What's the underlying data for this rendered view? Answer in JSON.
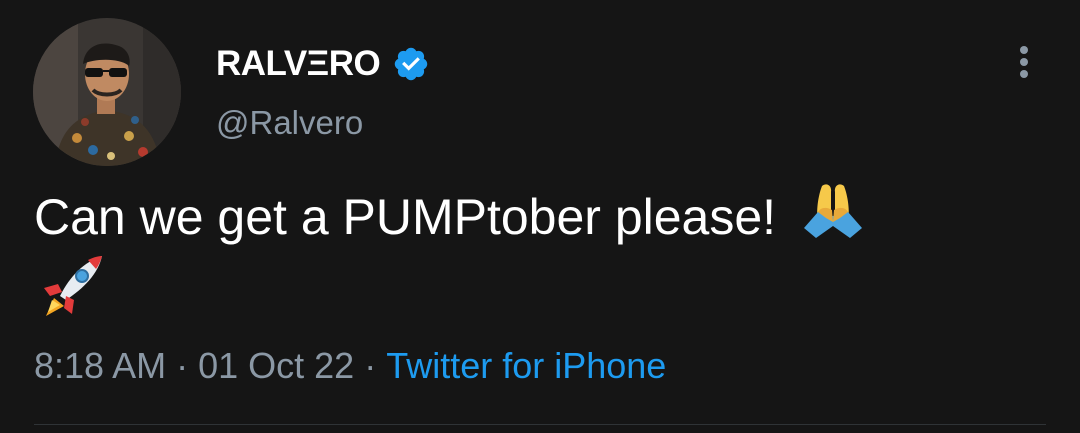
{
  "author": {
    "display_name": "RALVΞRO",
    "handle": "@Ralvero",
    "verified": true
  },
  "tweet": {
    "text": "Can we get a PUMPtober please!",
    "emojis": [
      "folded-hands",
      "rocket"
    ]
  },
  "meta": {
    "time": "8:18 AM",
    "separator": "·",
    "date": "01 Oct 22",
    "source": "Twitter for iPhone"
  },
  "icons": {
    "verified_badge": "verified-badge-icon",
    "more": "more-vertical-icon"
  },
  "colors": {
    "background": "#151515",
    "text_primary": "#ffffff",
    "text_secondary": "#8b98a5",
    "accent": "#1d9bf0"
  }
}
